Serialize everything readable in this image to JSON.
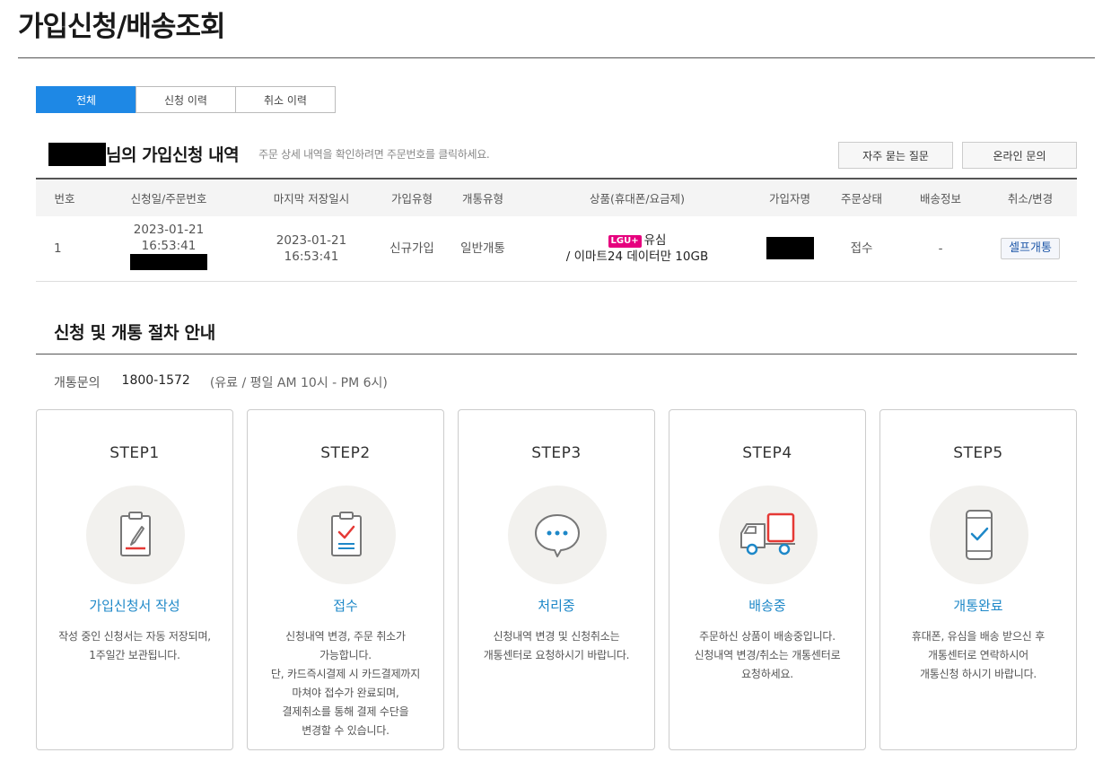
{
  "page": {
    "title": "가입신청/배송조회"
  },
  "tabs": [
    {
      "label": "전체"
    },
    {
      "label": "신청 이력"
    },
    {
      "label": "취소 이력"
    }
  ],
  "section": {
    "title_suffix": "님의 가입신청 내역",
    "description": "주문 상세 내역을 확인하려면 주문번호를 클릭하세요.",
    "faq_label": "자주 묻는 질문",
    "inquiry_label": "온라인 문의"
  },
  "table": {
    "headers": [
      "번호",
      "신청일/주문번호",
      "마지막 저장일시",
      "가입유형",
      "개통유형",
      "상품(휴대폰/요금제)",
      "가입자명",
      "주문상태",
      "배송정보",
      "취소/변경"
    ],
    "row": {
      "no": "1",
      "apply_date": "2023-01-21",
      "apply_time": "16:53:41",
      "saved_date": "2023-01-21",
      "saved_time": "16:53:41",
      "join_type": "신규가입",
      "open_type": "일반개통",
      "carrier_badge": "LGU+",
      "product_line1": "유심",
      "product_line2": "/ 이마트24 데이터만 10GB",
      "status": "접수",
      "delivery": "-",
      "action_label": "셀프개통"
    }
  },
  "guide": {
    "title": "신청 및 개통 절차 안내",
    "contact_label": "개통문의",
    "contact_number": "1800-1572",
    "contact_hours": "(유료 / 평일 AM 10시 - PM 6시)"
  },
  "steps": [
    {
      "no": "STEP1",
      "name": "가입신청서 작성",
      "desc": "작성 중인 신청서는 자동 저장되며,\n1주일간 보관됩니다.",
      "icon": "clipboard-pen-icon"
    },
    {
      "no": "STEP2",
      "name": "접수",
      "desc": "신청내역 변경, 주문 취소가\n가능합니다.\n단, 카드즉시결제 시 카드결제까지\n마쳐야 접수가 완료되며,\n결제취소를 통해 결제 수단을\n변경할 수 있습니다.",
      "icon": "clipboard-check-icon"
    },
    {
      "no": "STEP3",
      "name": "처리중",
      "desc": "신청내역 변경 및 신청취소는\n개통센터로 요청하시기 바랍니다.",
      "icon": "chat-bubble-icon"
    },
    {
      "no": "STEP4",
      "name": "배송중",
      "desc": "주문하신 상품이 배송중입니다.\n신청내역 변경/취소는 개통센터로\n요청하세요.",
      "icon": "truck-icon"
    },
    {
      "no": "STEP5",
      "name": "개통완료",
      "desc": "휴대폰, 유심을 배송 받으신 후\n개통센터로 연락하시어\n개통신청 하시기 바랍니다.",
      "icon": "phone-check-icon"
    }
  ]
}
